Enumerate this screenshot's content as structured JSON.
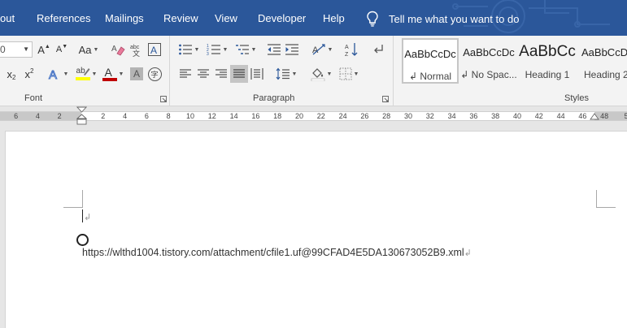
{
  "tabs": [
    {
      "label": "out"
    },
    {
      "label": "References"
    },
    {
      "label": "Mailings"
    },
    {
      "label": "Review"
    },
    {
      "label": "View"
    },
    {
      "label": "Developer"
    },
    {
      "label": "Help"
    }
  ],
  "tell_me": {
    "text": "Tell me what you want to do",
    "icon": "lightbulb-icon"
  },
  "ribbon": {
    "font_group": {
      "label": "Font",
      "font_size_value": "0",
      "grow_label": "A",
      "shrink_label": "A",
      "change_case_label": "Aa",
      "subscript_label": "x",
      "subscript_sub": "2",
      "superscript_label": "x",
      "superscript_sup": "2",
      "highlight_label": "ab",
      "font_color_label": "A",
      "char_shading_label": "A",
      "enclose_label": "字"
    },
    "paragraph_group": {
      "label": "Paragraph"
    },
    "styles_group": {
      "label": "Styles",
      "items": [
        {
          "preview": "AaBbCcDc",
          "name": "↲ Normal"
        },
        {
          "preview": "AaBbCcDc",
          "name": "↲ No Spac..."
        },
        {
          "preview": "AaBbCc",
          "name": "Heading 1"
        },
        {
          "preview": "AaBbCcD",
          "name": "Heading 2"
        }
      ]
    }
  },
  "ruler": {
    "ticks": [
      "6",
      "4",
      "2",
      "2",
      "4",
      "6",
      "8",
      "10",
      "12",
      "14",
      "16",
      "18",
      "20",
      "22",
      "24",
      "26",
      "28",
      "30",
      "32",
      "34",
      "36",
      "38",
      "40",
      "42",
      "44",
      "46",
      "48",
      "5"
    ]
  },
  "document": {
    "line1_mark": "↲",
    "url_text": "https://wlthd1004.tistory.com/attachment/cfile1.uf@99CFAD4E5DA130673052B9.xml",
    "url_mark": "↲"
  },
  "colors": {
    "title_bar": "#2b579a",
    "ribbon_bg": "#f3f3f3",
    "highlight_yellow": "#ffff00",
    "font_color_red": "#c00000",
    "text_effect_blue": "#4472c4"
  }
}
